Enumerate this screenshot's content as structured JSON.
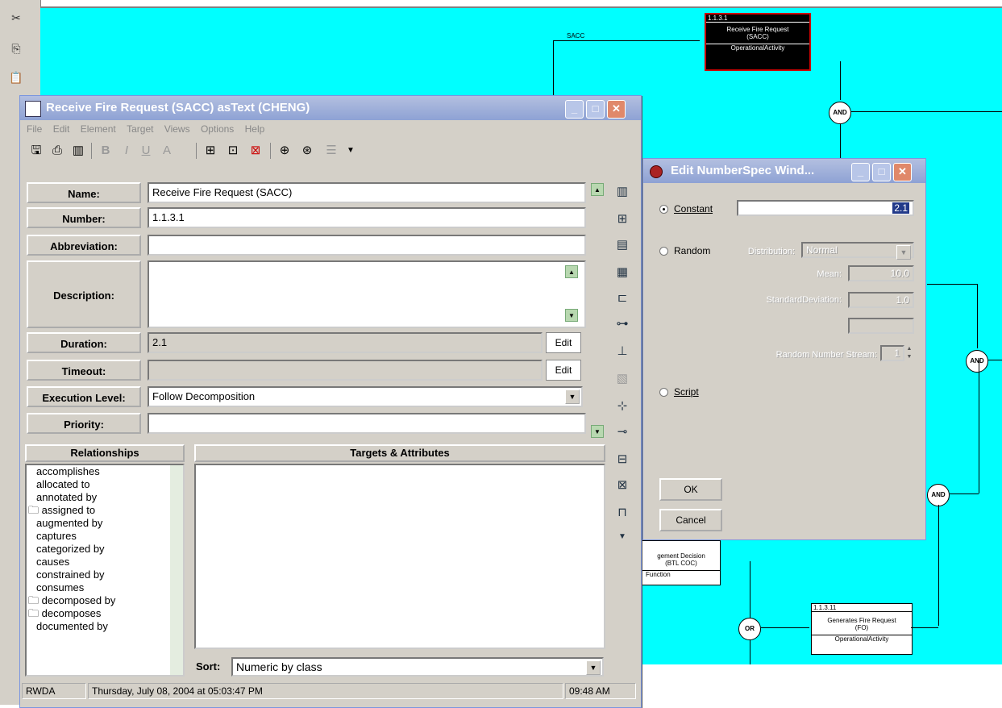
{
  "diagram": {
    "top_node": {
      "number": "1.1.3.1",
      "title_line1": "Receive Fire Request",
      "title_line2": "(SACC)",
      "class": "OperationalActivity"
    },
    "edge_label": "SACC",
    "connectors": [
      "AND",
      "AND",
      "AND",
      "OR"
    ],
    "partial_node": {
      "line1": "gement Decision",
      "line2": "(BTL COC)",
      "class": "Function"
    },
    "bottom_node": {
      "number": "1.1.3.11",
      "title_line1": "Generates Fire Request",
      "title_line2": "(FO)",
      "class": "OperationalActivity"
    }
  },
  "main_window": {
    "title": "Receive Fire Request (SACC) asText (CHENG)",
    "menu": [
      "File",
      "Edit",
      "Element",
      "Target",
      "Views",
      "Options",
      "Help"
    ],
    "fields": {
      "name_label": "Name:",
      "name_value": "Receive Fire Request (SACC)",
      "number_label": "Number:",
      "number_value": "1.1.3.1",
      "abbreviation_label": "Abbreviation:",
      "abbreviation_value": "",
      "description_label": "Description:",
      "description_value": "",
      "duration_label": "Duration:",
      "duration_value": "2.1",
      "timeout_label": "Timeout:",
      "timeout_value": "",
      "execution_label": "Execution Level:",
      "execution_value": "Follow Decomposition",
      "priority_label": "Priority:",
      "priority_value": "",
      "edit_label": "Edit"
    },
    "relationships_header": "Relationships",
    "targets_header": "Targets & Attributes",
    "relationships": [
      {
        "label": "accomplishes",
        "folder": false
      },
      {
        "label": "allocated to",
        "folder": false
      },
      {
        "label": "annotated by",
        "folder": false
      },
      {
        "label": "assigned to",
        "folder": true
      },
      {
        "label": "augmented by",
        "folder": false
      },
      {
        "label": "captures",
        "folder": false
      },
      {
        "label": "categorized by",
        "folder": false
      },
      {
        "label": "causes",
        "folder": false
      },
      {
        "label": "constrained by",
        "folder": false
      },
      {
        "label": "consumes",
        "folder": false
      },
      {
        "label": "decomposed by",
        "folder": true
      },
      {
        "label": "decomposes",
        "folder": true
      },
      {
        "label": "documented by",
        "folder": false
      }
    ],
    "sort_label": "Sort:",
    "sort_value": "Numeric by class",
    "status": {
      "user": "RWDA",
      "datetime": "Thursday, July 08, 2004 at 05:03:47 PM",
      "time": "09:48 AM"
    }
  },
  "dialog": {
    "title": "Edit NumberSpec Wind...",
    "constant_label": "Constant",
    "constant_value": "2.1",
    "random_label": "Random",
    "distribution_label": "Distribution:",
    "distribution_value": "Normal",
    "mean_label": "Mean:",
    "mean_value": "10.0",
    "stddev_label": "StandardDeviation:",
    "stddev_value": "1.0",
    "stream_label": "Random Number Stream:",
    "stream_value": "1",
    "script_label": "Script",
    "ok_label": "OK",
    "cancel_label": "Cancel"
  }
}
